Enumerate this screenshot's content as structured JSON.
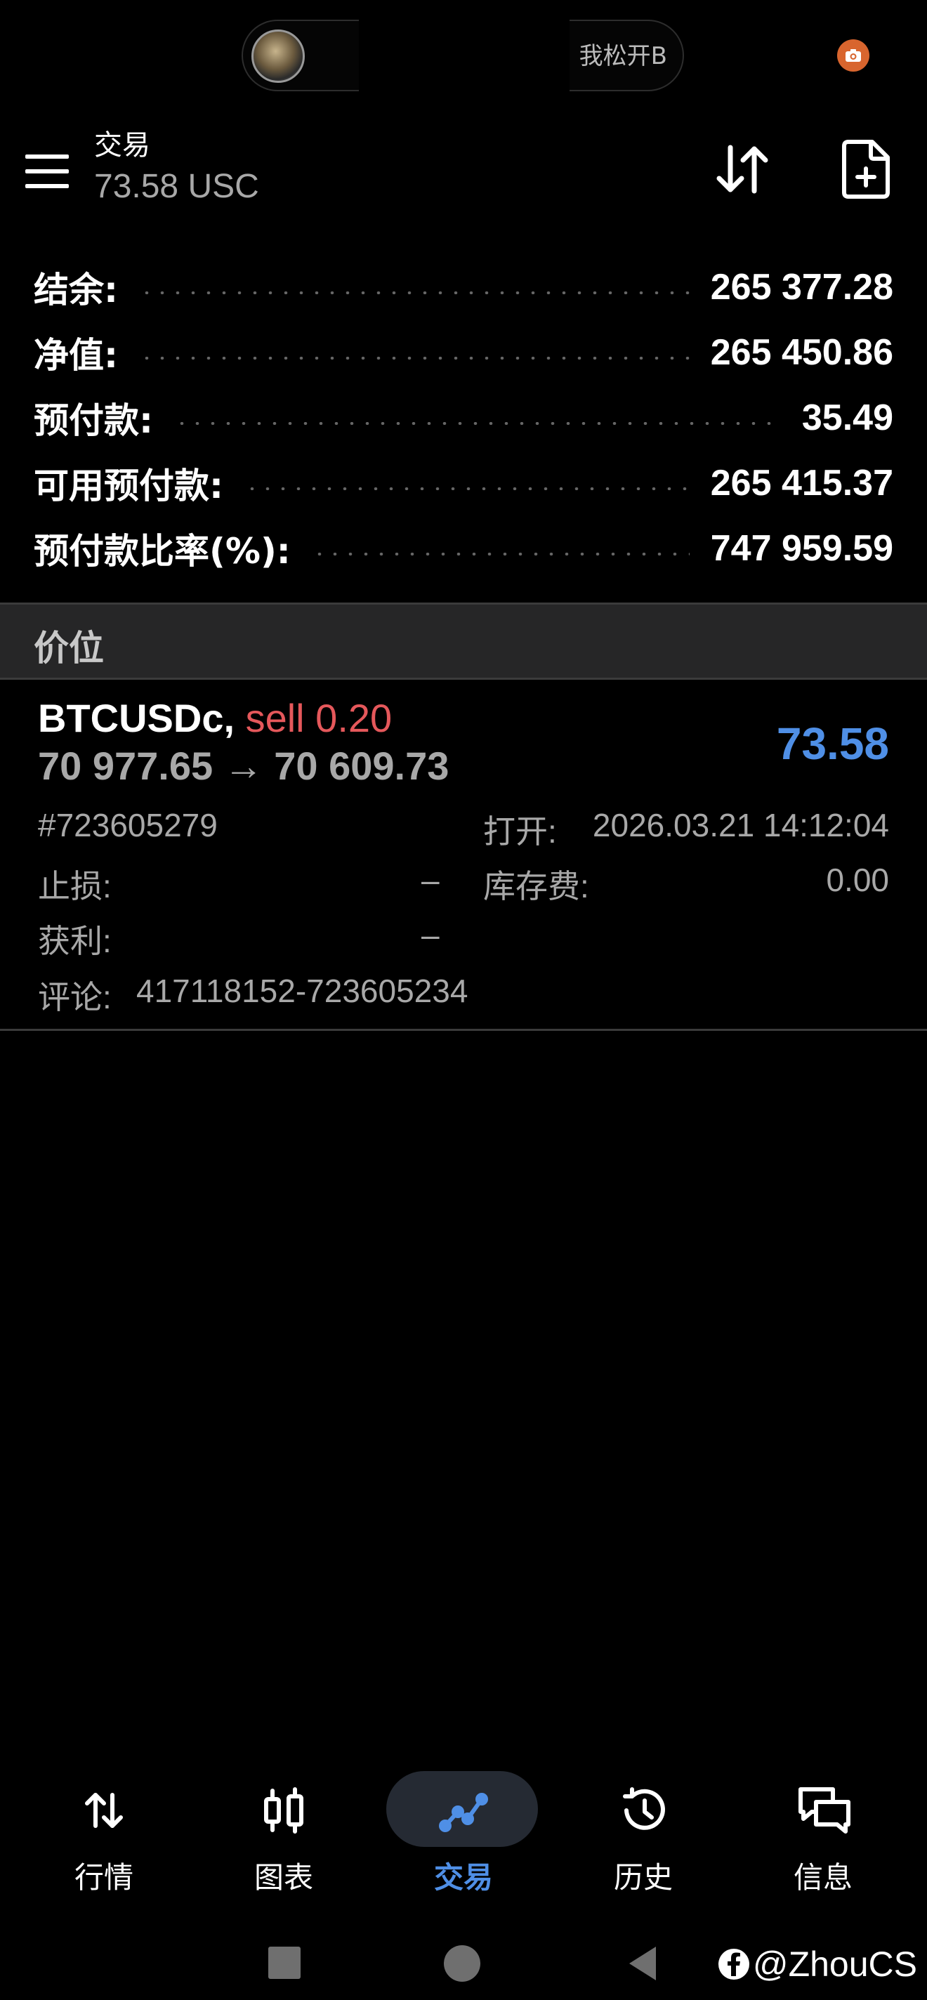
{
  "status": {
    "ticker_text": "我松开B"
  },
  "header": {
    "title": "交易",
    "subtitle": "73.58 USC"
  },
  "summary": [
    {
      "label": "结余:",
      "value": "265 377.28"
    },
    {
      "label": "净值:",
      "value": "265 450.86"
    },
    {
      "label": "预付款:",
      "value": "35.49"
    },
    {
      "label": "可用预付款:",
      "value": "265 415.37"
    },
    {
      "label": "预付款比率(%):",
      "value": "747 959.59"
    }
  ],
  "section": {
    "label": "价位"
  },
  "position": {
    "symbol": "BTCUSDc,",
    "side": "sell 0.20",
    "prices": "70 977.65 → 70 609.73",
    "profit": "73.58",
    "ticket": "#723605279",
    "open_label": "打开:",
    "open_value": "2026.03.21 14:12:04",
    "sl_label": "止损:",
    "sl_value": "–",
    "swap_label": "库存费:",
    "swap_value": "0.00",
    "tp_label": "获利:",
    "tp_value": "–",
    "comment_label": "评论:",
    "comment_value": "417118152-723605234"
  },
  "nav": [
    {
      "label": "行情",
      "icon": "quotes-arrows-icon"
    },
    {
      "label": "图表",
      "icon": "candlestick-icon"
    },
    {
      "label": "交易",
      "icon": "trade-line-icon",
      "active": true
    },
    {
      "label": "历史",
      "icon": "history-clock-icon"
    },
    {
      "label": "信息",
      "icon": "messages-icon"
    }
  ],
  "watermark": "@ZhouCS",
  "colors": {
    "accent_blue": "#4f8fe6",
    "sell_red": "#e5585b",
    "background": "#000000"
  }
}
